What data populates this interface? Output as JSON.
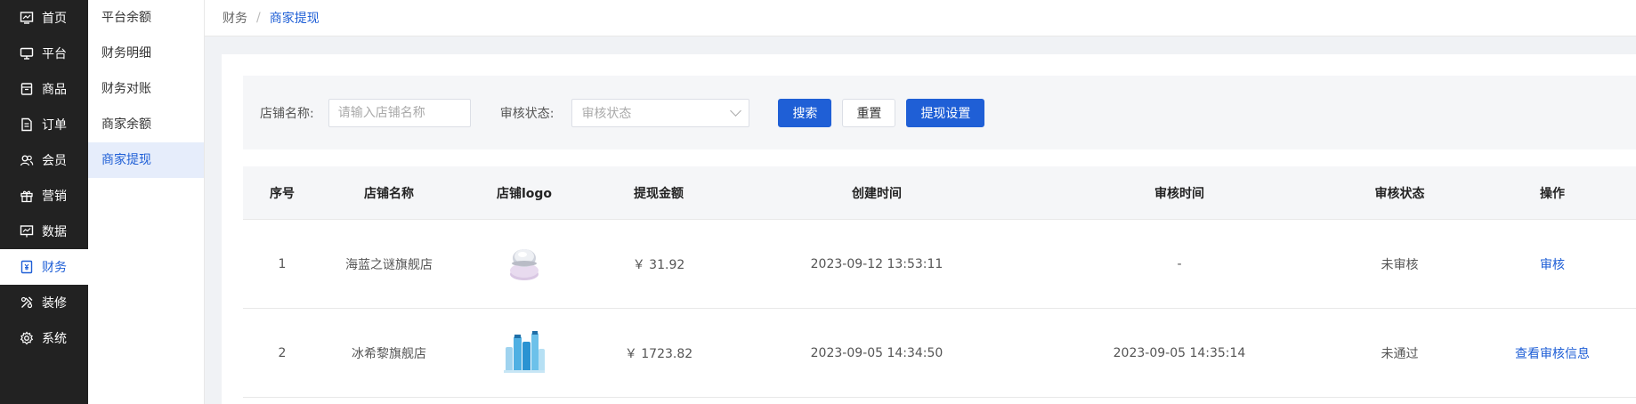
{
  "nav_primary": [
    {
      "label": "首页",
      "icon": "monitor-icon"
    },
    {
      "label": "平台",
      "icon": "desktop-icon"
    },
    {
      "label": "商品",
      "icon": "box-icon"
    },
    {
      "label": "订单",
      "icon": "document-icon"
    },
    {
      "label": "会员",
      "icon": "users-icon"
    },
    {
      "label": "营销",
      "icon": "gift-icon"
    },
    {
      "label": "数据",
      "icon": "chart-icon"
    },
    {
      "label": "财务",
      "icon": "finance-icon",
      "active": true
    },
    {
      "label": "装修",
      "icon": "decorate-icon"
    },
    {
      "label": "系统",
      "icon": "gear-icon"
    }
  ],
  "nav_secondary": [
    {
      "label": "平台余额"
    },
    {
      "label": "财务明细"
    },
    {
      "label": "财务对账"
    },
    {
      "label": "商家余额"
    },
    {
      "label": "商家提现",
      "active": true
    }
  ],
  "breadcrumb": {
    "root": "财务",
    "separator": "/",
    "current": "商家提现"
  },
  "filter": {
    "shop_label": "店铺名称:",
    "shop_placeholder": "请输入店铺名称",
    "status_label": "审核状态:",
    "status_placeholder": "审核状态",
    "search_btn": "搜索",
    "reset_btn": "重置",
    "settings_btn": "提现设置"
  },
  "table": {
    "headers": [
      "序号",
      "店铺名称",
      "店铺logo",
      "提现金额",
      "创建时间",
      "审核时间",
      "审核状态",
      "操作"
    ],
    "rows": [
      {
        "index": "1",
        "shop": "海蓝之谜旗舰店",
        "logo": "cosmetic-compact",
        "amount": "￥ 31.92",
        "created": "2023-09-12 13:53:11",
        "audited": "-",
        "status": "未审核",
        "action": "审核"
      },
      {
        "index": "2",
        "shop": "冰希黎旗舰店",
        "logo": "skincare-bottles",
        "amount": "￥ 1723.82",
        "created": "2023-09-05 14:34:50",
        "audited": "2023-09-05 14:35:14",
        "status": "未通过",
        "action": "查看审核信息"
      }
    ]
  },
  "colors": {
    "accent": "#1f5fd6",
    "sidebar_bg": "#222222"
  }
}
